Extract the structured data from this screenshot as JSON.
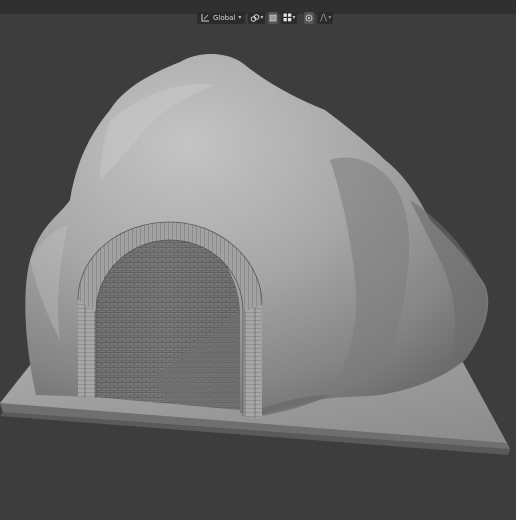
{
  "viewport_header": {
    "transform_orientation_label": "Global",
    "transform_orientation_icon": "transform-orientation-icon",
    "pivot_icon": "link-snap-icon",
    "snap_icon": "snap-grid-icon",
    "proportional_icon": "proportional-edit-icon",
    "falloff_icon": "falloff-curve-icon",
    "dropdown_icon": "chevron-down-icon"
  },
  "scene": {
    "object": "cave-tunnel-mesh",
    "base": "ground-plane",
    "colors": {
      "background": "#3d3d3d",
      "mesh_light": "#b8b8b8",
      "mesh_mid": "#8e8e8e",
      "mesh_dark": "#5c5c5c",
      "plane": "#9a9a9a"
    }
  }
}
